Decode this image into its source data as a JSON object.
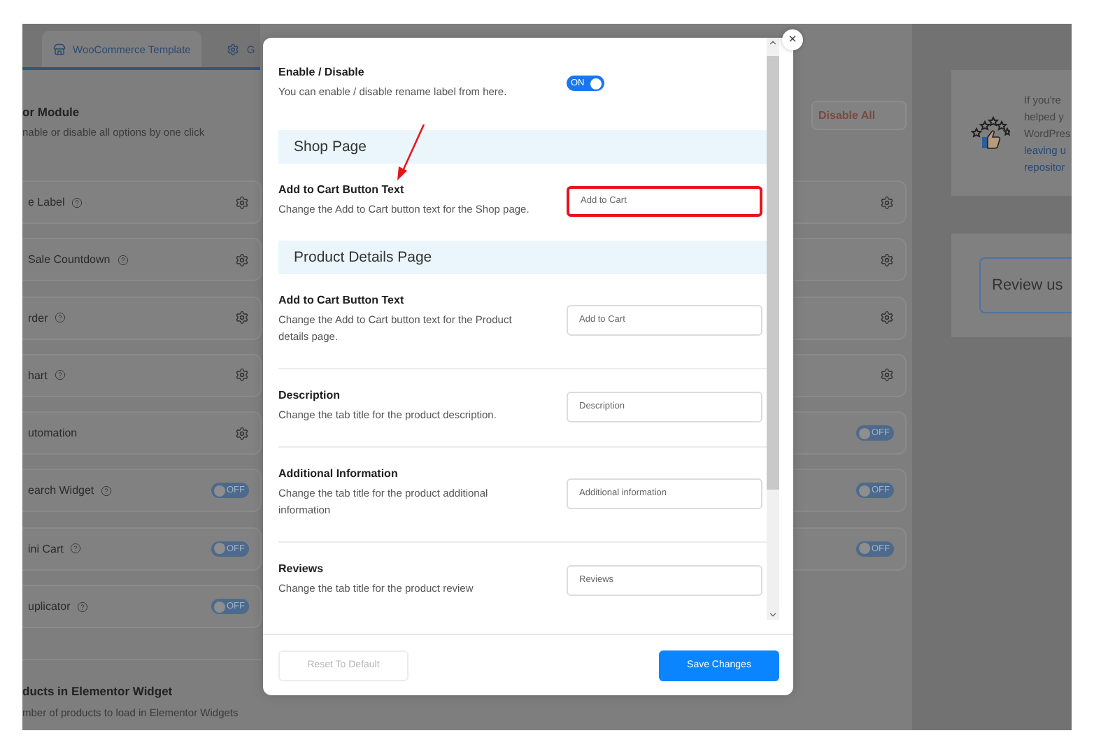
{
  "tabs": [
    {
      "label": "WooCommerce Template"
    },
    {
      "label": "G"
    }
  ],
  "module_panel": {
    "title": "or Module",
    "subtitle": "nable or disable all options by one click",
    "disable_all": "Disable All",
    "columns": [
      [
        {
          "name": "e Label",
          "help": true,
          "kind": "settings"
        },
        {
          "name": "Sale Countdown",
          "help": true,
          "kind": "settings"
        },
        {
          "name": "rder",
          "help": true,
          "kind": "settings"
        },
        {
          "name": "hart",
          "help": true,
          "kind": "settings"
        },
        {
          "name": "utomation",
          "help": false,
          "kind": "settings"
        },
        {
          "name": "earch Widget",
          "help": true,
          "kind": "toggle",
          "toggle_label": "OFF",
          "on": false
        },
        {
          "name": "ini Cart",
          "help": true,
          "kind": "toggle",
          "toggle_label": "OFF",
          "on": false
        },
        {
          "name": "uplicator",
          "help": true,
          "kind": "toggle",
          "toggle_label": "OFF",
          "on": false
        }
      ],
      [
        {
          "kind": "settings"
        },
        {
          "kind": "settings"
        },
        {
          "kind": "settings"
        },
        {
          "kind": "settings"
        },
        {
          "kind": "toggle",
          "toggle_label": "OFF",
          "on": false
        },
        {
          "kind": "toggle",
          "toggle_label": "OFF",
          "on": false
        },
        {
          "kind": "toggle",
          "toggle_label": "OFF",
          "on": false
        }
      ]
    ]
  },
  "products_setting": {
    "title": "ducts in Elementor Widget",
    "description": "mber of products to load in Elementor Widgets"
  },
  "sidebar": {
    "review_text": [
      "If you're",
      "helped y",
      "WordPres"
    ],
    "review_link": [
      "leaving u",
      "repositor"
    ],
    "review_button": "Review us"
  },
  "modal": {
    "close": "×",
    "enable": {
      "title": "Enable / Disable",
      "description": "You can enable / disable rename label from here.",
      "toggle_label": "ON",
      "on": true
    },
    "sections": [
      {
        "title": "Shop Page",
        "fields": [
          {
            "label": "Add to Cart Button Text",
            "description": "Change the Add to Cart button text for the Shop page.",
            "value": "Add to Cart",
            "highlighted": true
          }
        ]
      },
      {
        "title": "Product Details Page",
        "fields": [
          {
            "label": "Add to Cart Button Text",
            "description": "Change the Add to Cart button text for the Product details page.",
            "value": "Add to Cart",
            "highlighted": false
          },
          {
            "label": "Description",
            "description": "Change the tab title for the product description.",
            "value": "Description",
            "highlighted": false
          },
          {
            "label": "Additional Information",
            "description": "Change the tab title for the product additional information",
            "value": "Additional information",
            "highlighted": false
          },
          {
            "label": "Reviews",
            "description": "Change the tab title for the product review",
            "value": "Reviews",
            "highlighted": false
          }
        ]
      }
    ],
    "reset": {
      "label": "Reset To Default",
      "disabled": true
    },
    "save": "Save Changes"
  }
}
